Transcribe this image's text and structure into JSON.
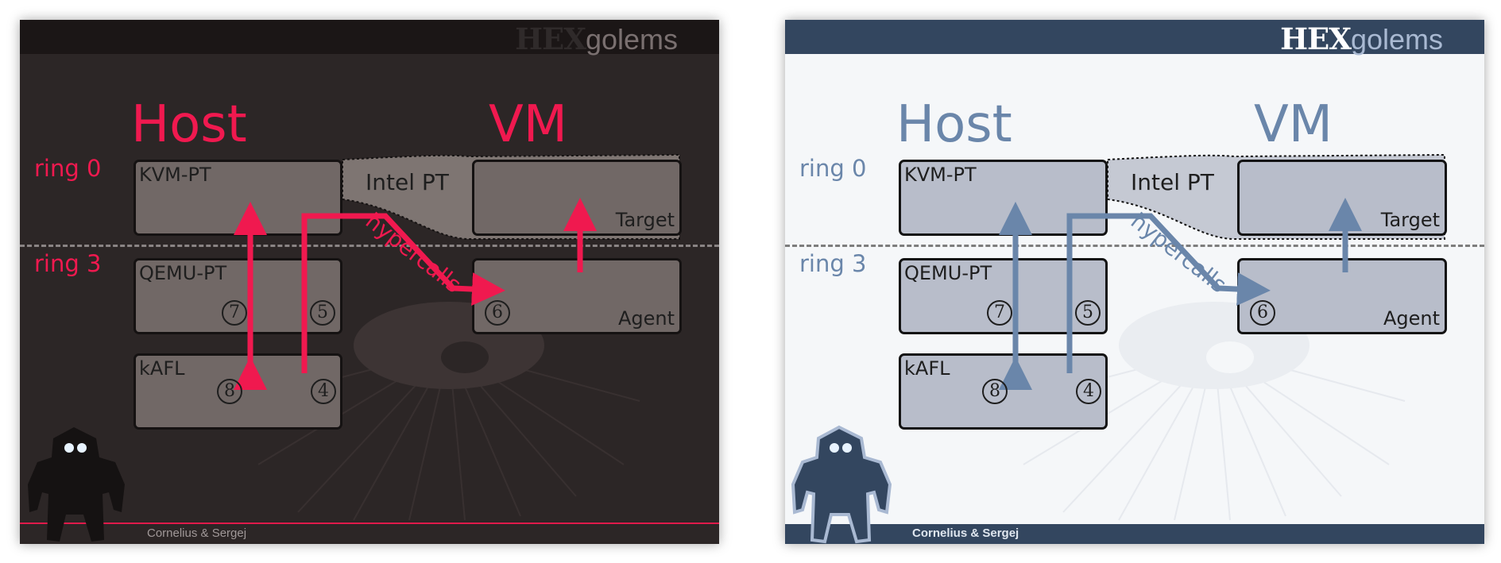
{
  "slides": [
    {
      "theme": "dark",
      "logo_hex": "HEX",
      "logo_golems": "golems",
      "host": "Host",
      "vm": "VM",
      "ring0": "ring 0",
      "ring3": "ring 3",
      "kvm": "KVM-PT",
      "intel_pt": "Intel PT",
      "target": "Target",
      "qemu": "QEMU-PT",
      "agent": "Agent",
      "kafl": "kAFL",
      "hypercalls": "hypercalls",
      "n7": "7",
      "n5": "5",
      "n6": "6",
      "n8": "8",
      "n4": "4",
      "footer": "Cornelius & Sergej",
      "accent": "#f0194f"
    },
    {
      "theme": "light",
      "logo_hex": "HEX",
      "logo_golems": "golems",
      "host": "Host",
      "vm": "VM",
      "ring0": "ring 0",
      "ring3": "ring 3",
      "kvm": "KVM-PT",
      "intel_pt": "Intel PT",
      "target": "Target",
      "qemu": "QEMU-PT",
      "agent": "Agent",
      "kafl": "kAFL",
      "hypercalls": "hypercalls",
      "n7": "7",
      "n5": "5",
      "n6": "6",
      "n8": "8",
      "n4": "4",
      "footer": "Cornelius & Sergej",
      "accent": "#6a86aa"
    }
  ]
}
